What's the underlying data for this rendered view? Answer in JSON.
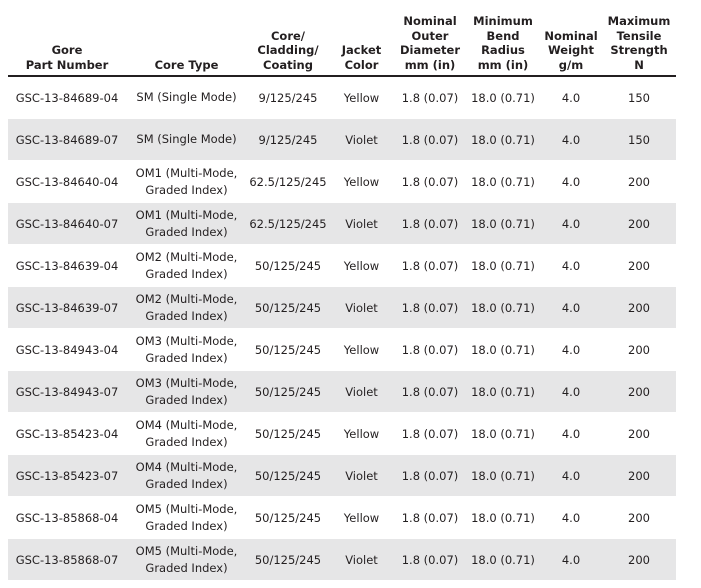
{
  "table": {
    "headers": [
      [
        "Gore",
        "Part Number"
      ],
      [
        "Core Type"
      ],
      [
        "Core/",
        "Cladding/",
        "Coating"
      ],
      [
        "Jacket",
        "Color"
      ],
      [
        "Nominal",
        "Outer",
        "Diameter",
        "mm (in)"
      ],
      [
        "Minimum",
        "Bend",
        "Radius",
        "mm (in)"
      ],
      [
        "Nominal",
        "Weight",
        "g/m"
      ],
      [
        "Maximum",
        "Tensile",
        "Strength",
        "N"
      ]
    ],
    "rows": [
      {
        "part": "GSC-13-84689-04",
        "core_type": [
          "SM (Single Mode)"
        ],
        "ccc": "9/125/245",
        "jacket": "Yellow",
        "diameter": "1.8 (0.07)",
        "bend": "18.0 (0.71)",
        "weight": "4.0",
        "tensile": "150"
      },
      {
        "part": "GSC-13-84689-07",
        "core_type": [
          "SM (Single Mode)"
        ],
        "ccc": "9/125/245",
        "jacket": "Violet",
        "diameter": "1.8 (0.07)",
        "bend": "18.0 (0.71)",
        "weight": "4.0",
        "tensile": "150"
      },
      {
        "part": "GSC-13-84640-04",
        "core_type": [
          "OM1 (Multi-Mode,",
          "Graded Index)"
        ],
        "ccc": "62.5/125/245",
        "jacket": "Yellow",
        "diameter": "1.8 (0.07)",
        "bend": "18.0 (0.71)",
        "weight": "4.0",
        "tensile": "200"
      },
      {
        "part": "GSC-13-84640-07",
        "core_type": [
          "OM1 (Multi-Mode,",
          "Graded Index)"
        ],
        "ccc": "62.5/125/245",
        "jacket": "Violet",
        "diameter": "1.8 (0.07)",
        "bend": "18.0 (0.71)",
        "weight": "4.0",
        "tensile": "200"
      },
      {
        "part": "GSC-13-84639-04",
        "core_type": [
          "OM2 (Multi-Mode,",
          "Graded Index)"
        ],
        "ccc": "50/125/245",
        "jacket": "Yellow",
        "diameter": "1.8 (0.07)",
        "bend": "18.0 (0.71)",
        "weight": "4.0",
        "tensile": "200"
      },
      {
        "part": "GSC-13-84639-07",
        "core_type": [
          "OM2 (Multi-Mode,",
          "Graded Index)"
        ],
        "ccc": "50/125/245",
        "jacket": "Violet",
        "diameter": "1.8 (0.07)",
        "bend": "18.0 (0.71)",
        "weight": "4.0",
        "tensile": "200"
      },
      {
        "part": "GSC-13-84943-04",
        "core_type": [
          "OM3 (Multi-Mode,",
          "Graded Index)"
        ],
        "ccc": "50/125/245",
        "jacket": "Yellow",
        "diameter": "1.8 (0.07)",
        "bend": "18.0 (0.71)",
        "weight": "4.0",
        "tensile": "200"
      },
      {
        "part": "GSC-13-84943-07",
        "core_type": [
          "OM3 (Multi-Mode,",
          "Graded Index)"
        ],
        "ccc": "50/125/245",
        "jacket": "Violet",
        "diameter": "1.8 (0.07)",
        "bend": "18.0 (0.71)",
        "weight": "4.0",
        "tensile": "200"
      },
      {
        "part": "GSC-13-85423-04",
        "core_type": [
          "OM4 (Multi-Mode,",
          "Graded Index)"
        ],
        "ccc": "50/125/245",
        "jacket": "Yellow",
        "diameter": "1.8 (0.07)",
        "bend": "18.0 (0.71)",
        "weight": "4.0",
        "tensile": "200"
      },
      {
        "part": "GSC-13-85423-07",
        "core_type": [
          "OM4 (Multi-Mode,",
          "Graded Index)"
        ],
        "ccc": "50/125/245",
        "jacket": "Violet",
        "diameter": "1.8 (0.07)",
        "bend": "18.0 (0.71)",
        "weight": "4.0",
        "tensile": "200"
      },
      {
        "part": "GSC-13-85868-04",
        "core_type": [
          "OM5 (Multi-Mode,",
          "Graded Index)"
        ],
        "ccc": "50/125/245",
        "jacket": "Yellow",
        "diameter": "1.8 (0.07)",
        "bend": "18.0 (0.71)",
        "weight": "4.0",
        "tensile": "200"
      },
      {
        "part": "GSC-13-85868-07",
        "core_type": [
          "OM5 (Multi-Mode,",
          "Graded Index)"
        ],
        "ccc": "50/125/245",
        "jacket": "Violet",
        "diameter": "1.8 (0.07)",
        "bend": "18.0 (0.71)",
        "weight": "4.0",
        "tensile": "200"
      }
    ]
  },
  "colors": {
    "text": "#231f20",
    "shaded_row": "#e6e6e7",
    "header_rule": "#231f20"
  }
}
